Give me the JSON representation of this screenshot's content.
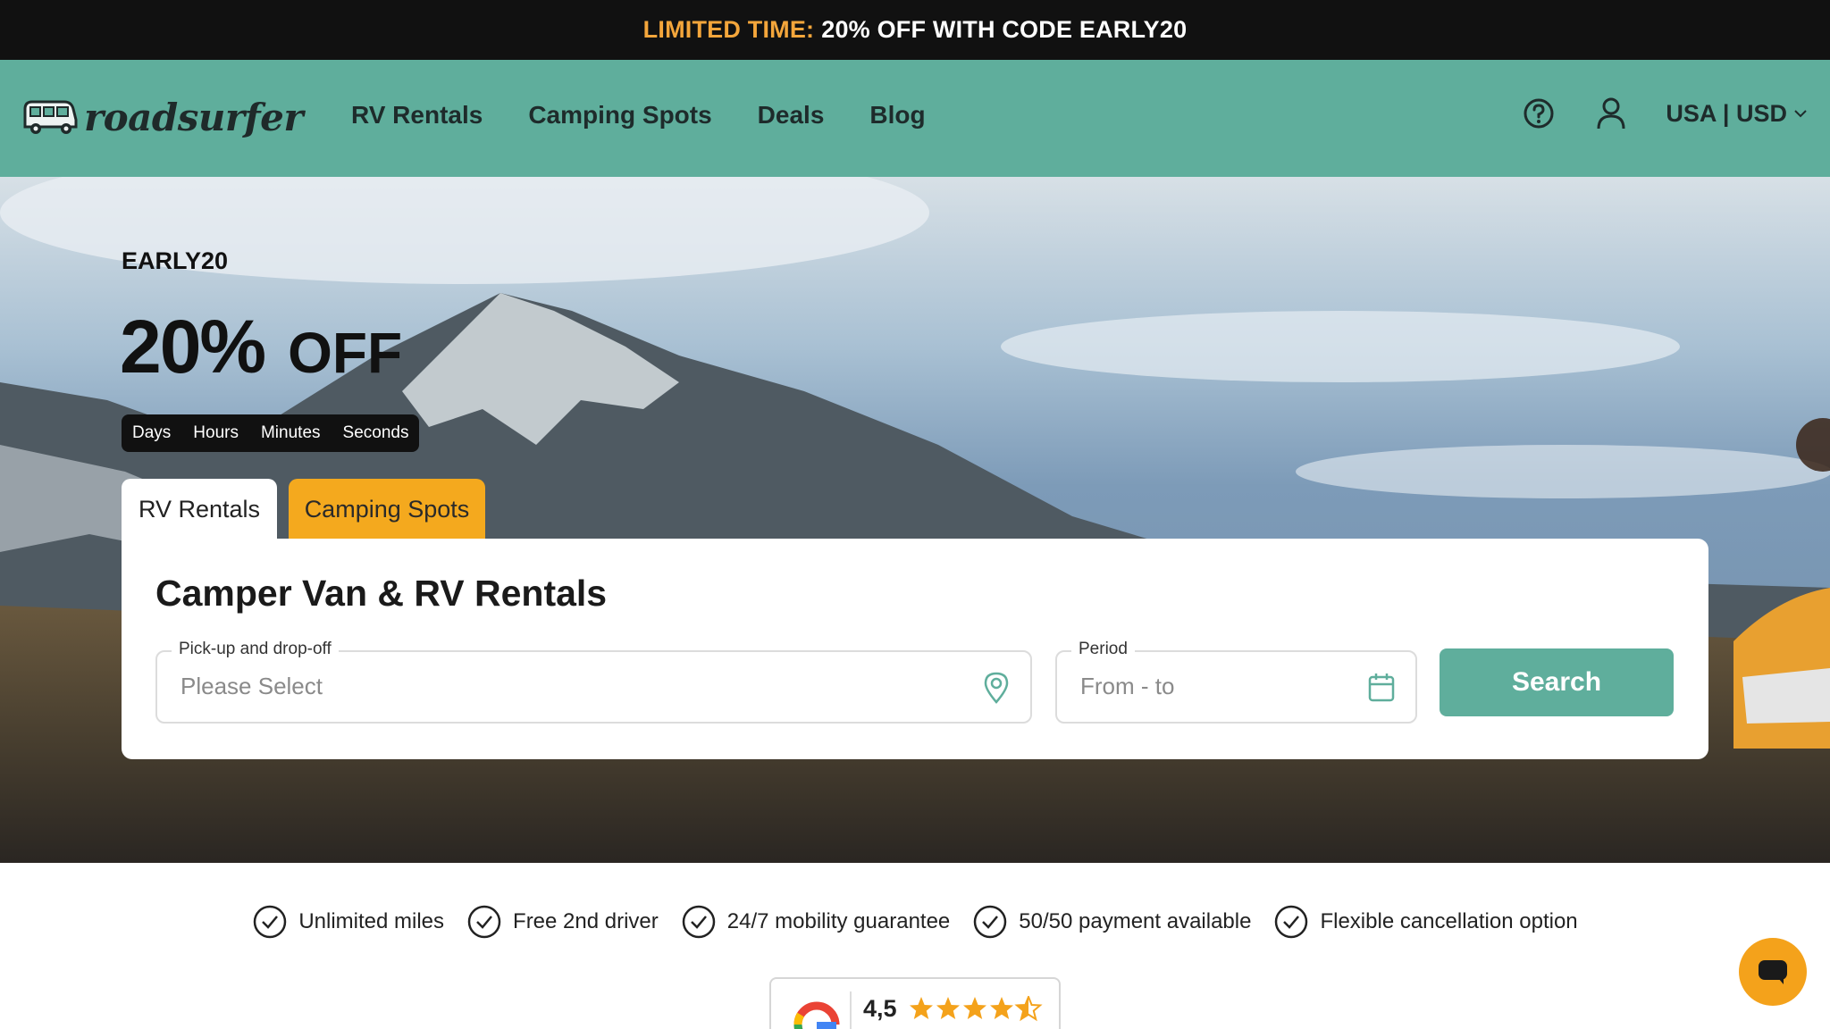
{
  "promo_bar": {
    "accent": "LIMITED TIME:",
    "text": "20% OFF WITH CODE EARLY20"
  },
  "header": {
    "logo_text": "roadsurfer",
    "nav": [
      "RV Rentals",
      "Camping Spots",
      "Deals",
      "Blog"
    ],
    "locale": "USA | USD",
    "icons": [
      "help-icon",
      "user-icon",
      "chevron-down-icon"
    ]
  },
  "hero": {
    "promo_code": "EARLY20",
    "discount": "20%",
    "off": "OFF",
    "countdown": [
      "Days",
      "Hours",
      "Minutes",
      "Seconds"
    ],
    "tabs": [
      "RV Rentals",
      "Camping Spots"
    ],
    "card_title": "Camper Van & RV Rentals",
    "pickup": {
      "label": "Pick-up and drop-off",
      "placeholder": "Please Select"
    },
    "period": {
      "label": "Period",
      "placeholder": "From - to"
    },
    "search_label": "Search"
  },
  "features": [
    "Unlimited miles",
    "Free 2nd driver",
    "24/7 mobility guarantee",
    "50/50 payment available",
    "Flexible cancellation option"
  ],
  "rating": {
    "value": "4,5",
    "stars": 4.5
  },
  "colors": {
    "brand": "#5fae9c",
    "accent": "#f4a91e",
    "promo_accent": "#f4a63b",
    "dark": "#111111"
  }
}
